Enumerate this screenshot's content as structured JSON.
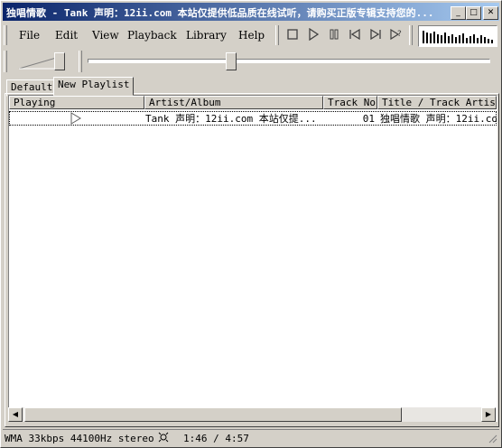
{
  "window": {
    "title": "独唱情歌 - Tank 声明：12ii.com 本站仅提供低品质在线试听，请购买正版专辑支持您的...",
    "min_symbol": "_",
    "max_symbol": "□",
    "close_symbol": "✕"
  },
  "menu": [
    {
      "label": "File"
    },
    {
      "label": "Edit"
    },
    {
      "label": "View"
    },
    {
      "label": "Playback"
    },
    {
      "label": "Library"
    },
    {
      "label": "Help"
    }
  ],
  "controls": {
    "stop_icon": "stop-icon",
    "play_icon": "play-icon",
    "pause_icon": "pause-icon",
    "prev_icon": "previous-icon",
    "next_icon": "next-icon",
    "random_icon": "random-icon"
  },
  "volume_level": 0.85,
  "seek_position": 0.35,
  "tabs": [
    "Default",
    "New Playlist"
  ],
  "active_tab": 1,
  "columns": [
    "Playing",
    "Artist/Album",
    "Track No",
    "Title / Track Artist"
  ],
  "rows": [
    {
      "playing_icon": "play-outline-icon",
      "artist_album": "Tank 声明：12ii.com 本站仅提...",
      "track_no": "01",
      "title": "独唱情歌 声明：12ii.com"
    }
  ],
  "status": {
    "format": "WMA 33kbps 44100Hz stereo",
    "time": "1:46 / 4:57"
  },
  "colors": {
    "title_start": "#0a246a",
    "title_end": "#a6caf0",
    "face": "#d4d0c8"
  }
}
